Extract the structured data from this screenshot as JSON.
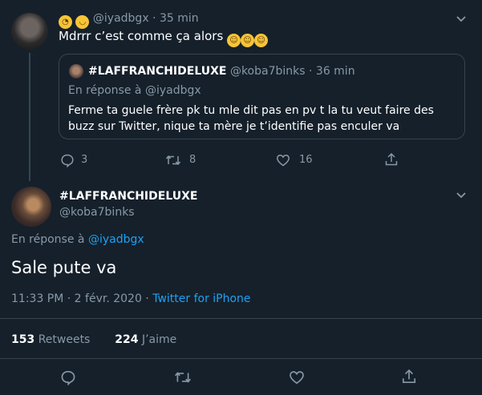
{
  "tweet1": {
    "handle": "@iyadbgx",
    "separator": "·",
    "time": "35 min",
    "text": "Mdrrr c’est comme ça alors",
    "emojis_lead": [
      "yawning-face-emoji",
      "pensive-face-emoji"
    ],
    "emojis_trail": [
      "rofl-emoji",
      "rofl-emoji",
      "rofl-emoji"
    ],
    "actions": {
      "reply": "3",
      "retweet": "8",
      "like": "16"
    }
  },
  "quote": {
    "display_name": "#LAFFRANCHIDELUXE",
    "handle": "@koba7binks",
    "separator": "·",
    "time": "36 min",
    "reply_to": "En réponse à @iyadbgx",
    "text": "Ferme ta guele frère pk tu mle dit pas en pv t la tu veut faire des buzz sur Twitter, nique ta mère je t’identifie pas enculer va"
  },
  "tweet2": {
    "display_name": "#LAFFRANCHIDELUXE",
    "handle": "@koba7binks",
    "reply_prefix": "En réponse à",
    "reply_handle": "@iyadbgx",
    "text": "Sale pute va",
    "timestamp": "11:33 PM · 2 févr. 2020 · ",
    "source": "Twitter for iPhone",
    "retweets_count": "153",
    "retweets_label": "Retweets",
    "likes_count": "224",
    "likes_label": "J’aime"
  },
  "colors": {
    "background": "#15202b",
    "muted": "#8899a6",
    "accent": "#1da1f2",
    "border": "#38444d"
  }
}
